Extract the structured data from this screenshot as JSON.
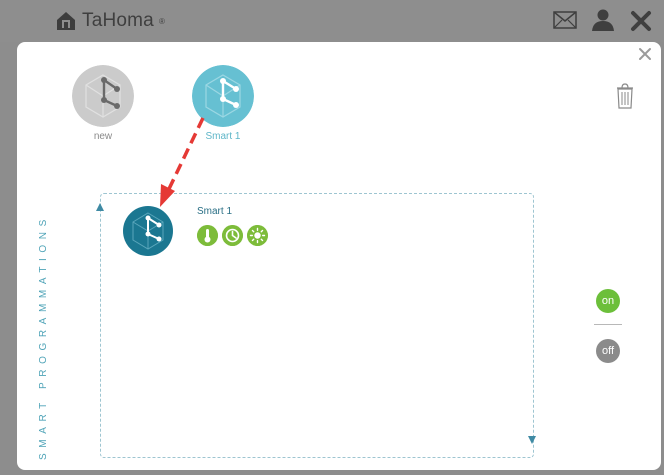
{
  "app": {
    "name": "TaHoma",
    "reg": "®"
  },
  "header_icons": [
    "mail-icon",
    "user-icon",
    "close-icon"
  ],
  "programs": [
    {
      "label": "new",
      "state": "inactive"
    },
    {
      "label": "Smart 1",
      "state": "selected"
    }
  ],
  "section_label": "SMART PROGRAMMATIONS",
  "active_program": {
    "title": "Smart 1",
    "triggers": [
      "thermometer-icon",
      "clock-icon",
      "sun-icon"
    ]
  },
  "toggle": {
    "on_label": "on",
    "off_label": "off"
  },
  "colors": {
    "topbar": "#8e8e8e",
    "teal": "#5fb6c8",
    "teal_dark": "#1b7791",
    "green": "#7dbc3a",
    "red_arrow": "#e53935"
  }
}
